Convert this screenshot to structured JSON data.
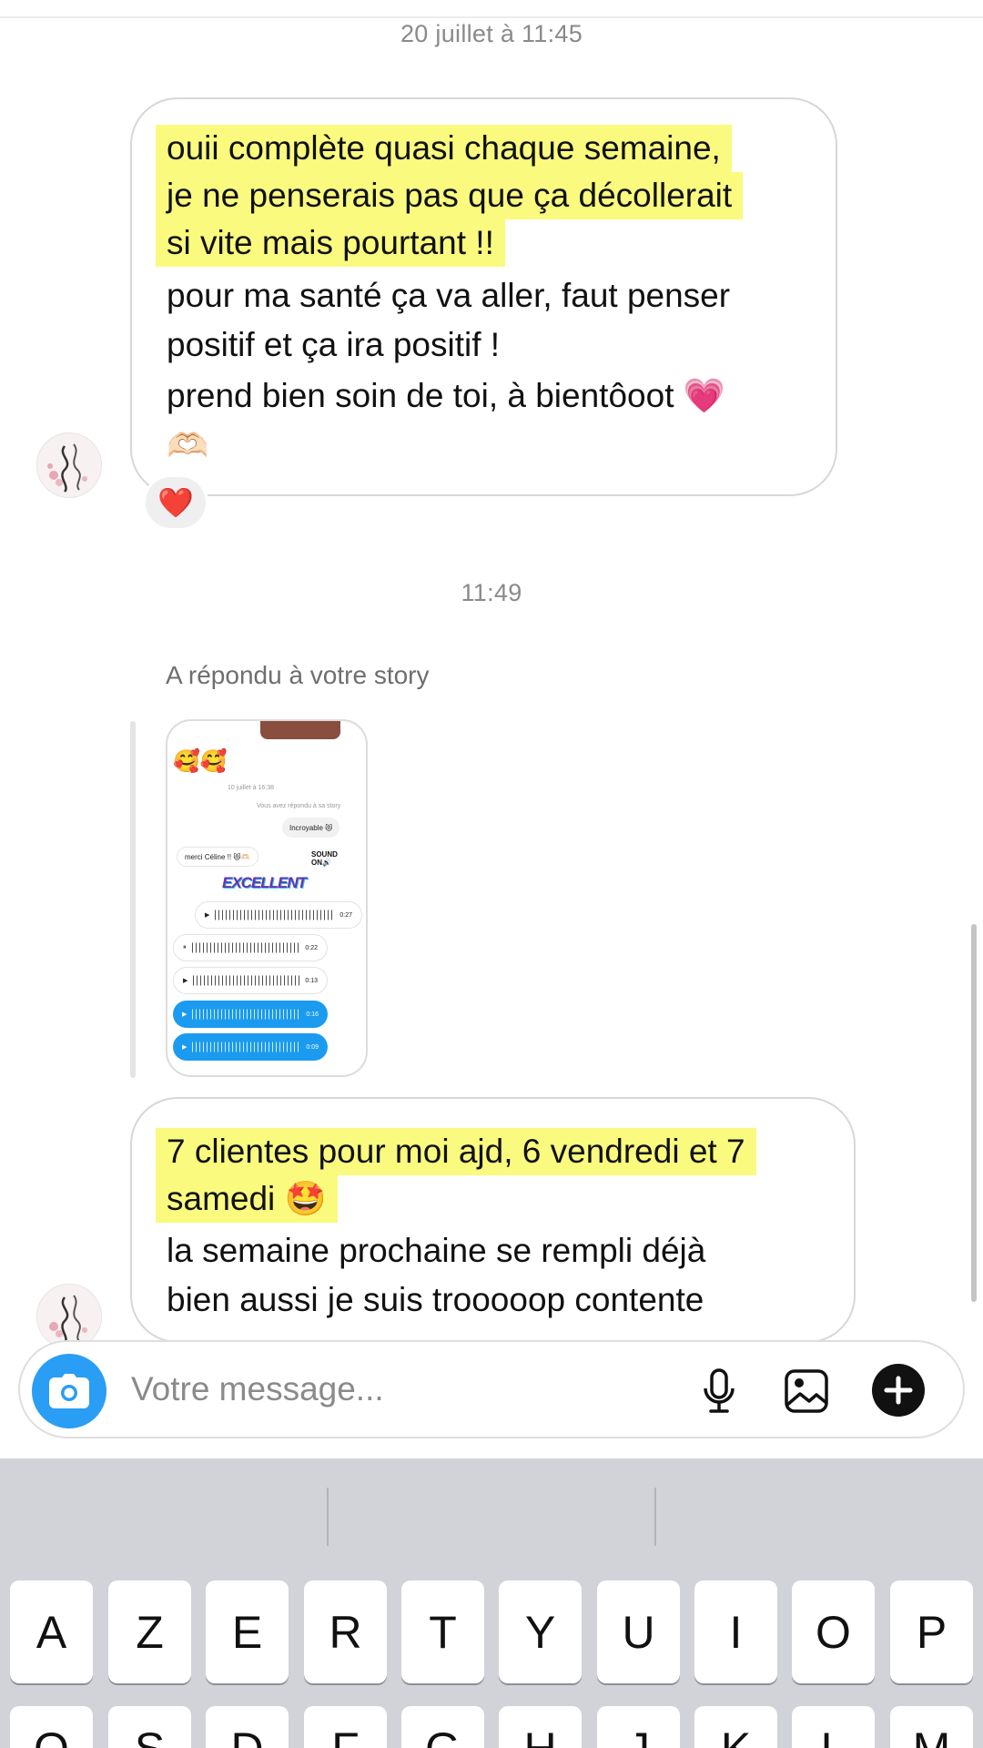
{
  "thread": {
    "timestamp_1": "20 juillet à 11:45",
    "message_1": {
      "lines": [
        {
          "text": "ouii complète quasi chaque semaine,",
          "highlight": true
        },
        {
          "text": "je ne penserais pas que ça décollerait",
          "highlight": true
        },
        {
          "text": "si vite mais pourtant !!",
          "highlight": true
        },
        {
          "text": "pour ma santé ça va aller, faut penser",
          "highlight": false
        },
        {
          "text": "positif et ça ira positif !",
          "highlight": false
        },
        {
          "text": "prend bien soin de toi, à bientôoot 💗",
          "highlight": false
        },
        {
          "text": "🫶🏻",
          "highlight": false
        }
      ],
      "reaction": "❤️"
    },
    "timestamp_2": "11:49",
    "story_reply": {
      "label": "A répondu à votre story",
      "preview": {
        "emojis": "🥰🥰",
        "date": "10 juillet à 16:38",
        "replied_note": "Vous avez répondu à sa story",
        "bubble_right": "Incroyable 😻",
        "bubble_left": "merci Céline !! 😻🫶🏻",
        "sound_badge": "SOUND ON🔊",
        "sticker": "EXCELLENT",
        "voice_notes": [
          {
            "icon": "▶",
            "time": "0:27",
            "style": "grey"
          },
          {
            "icon": "⏸",
            "time": "0:22",
            "style": "grey"
          },
          {
            "icon": "▶",
            "time": "0:13",
            "style": "grey"
          },
          {
            "icon": "▶",
            "time": "0:16",
            "style": "blue"
          },
          {
            "icon": "▶",
            "time": "0:09",
            "style": "blue"
          }
        ]
      }
    },
    "message_2": {
      "lines": [
        {
          "text": "7 clientes pour moi ajd, 6 vendredi et 7",
          "highlight": true
        },
        {
          "text": "samedi 🤩",
          "highlight": true
        },
        {
          "text": "la semaine prochaine se rempli déjà",
          "highlight": false
        },
        {
          "text": "bien aussi je suis trooooop contente",
          "highlight": false
        }
      ]
    }
  },
  "composer": {
    "placeholder": "Votre message...",
    "icons": {
      "camera": "camera-icon",
      "mic": "microphone-icon",
      "gallery": "image-icon",
      "add": "plus-icon"
    },
    "camera_color": "#2a9df4"
  },
  "keyboard": {
    "row1": [
      "A",
      "Z",
      "E",
      "R",
      "T",
      "Y",
      "U",
      "I",
      "O",
      "P"
    ],
    "row2": [
      "Q",
      "S",
      "D",
      "F",
      "G",
      "H",
      "J",
      "K",
      "L",
      "M"
    ]
  },
  "colors": {
    "highlight": "#fafb7e",
    "keyboard_bg": "#d2d3d8",
    "bubble_border": "#d7d7d7"
  }
}
